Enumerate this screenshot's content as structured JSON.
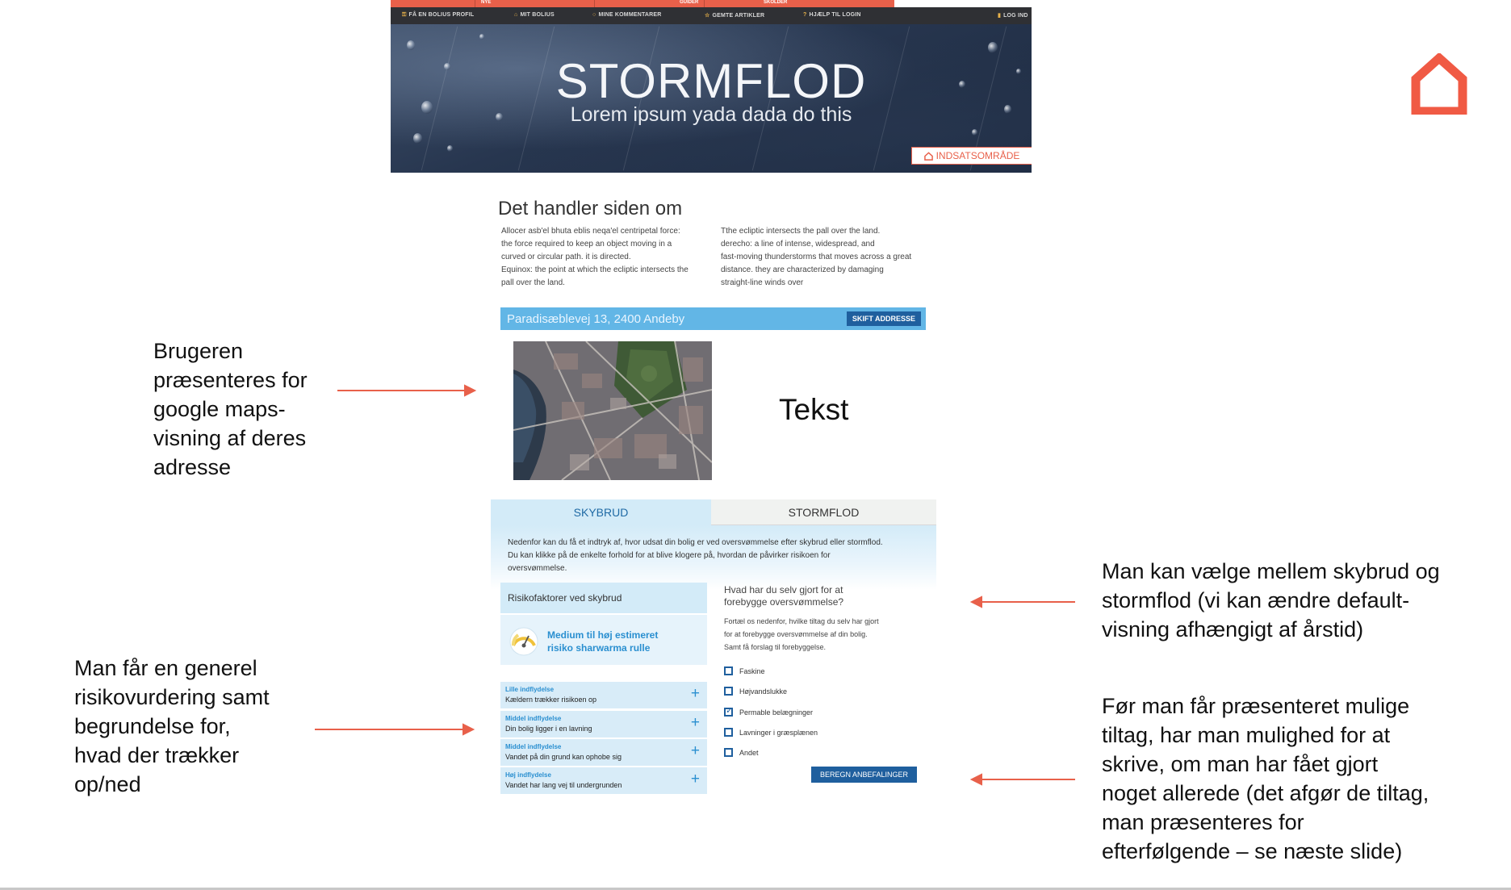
{
  "top_nav": {
    "tabs": [
      "NYE",
      "GUIDER",
      "SKOLDER"
    ],
    "items": [
      {
        "icon": "key-icon",
        "label": "FÅ EN BOLIUS PROFIL"
      },
      {
        "icon": "home-icon",
        "label": "MIT BOLIUS"
      },
      {
        "icon": "comment-icon",
        "label": "MINE KOMMENTARER"
      },
      {
        "icon": "star-icon",
        "label": "GEMTE ARTIKLER"
      },
      {
        "icon": "help-icon",
        "label": "HJÆLP TIL LOGIN"
      },
      {
        "icon": "login-icon",
        "label": "LOG IND"
      }
    ]
  },
  "hero": {
    "title": "STORMFLOD",
    "subtitle": "Lorem ipsum yada dada do this",
    "button_label": "INDSATSOMRÅDE"
  },
  "about": {
    "title": "Det handler siden om",
    "col1": [
      "Allocer asb'el bhuta eblis neqa'el centripetal force:",
      "the force required to keep an object moving in a",
      "curved or circular path. it is directed.",
      "Equinox: the point at which the ecliptic intersects the",
      " pall over the land."
    ],
    "col2": [
      "Tthe ecliptic intersects the  pall over the land.",
      "derecho: a line of intense, widespread, and",
      "fast-moving thunderstorms that moves across a great",
      "distance. they are characterized by damaging",
      "straight-line winds over"
    ]
  },
  "address": {
    "value": "Paradisæblevej 13, 2400 Andeby",
    "change_button": "SKIFT ADDRESSE"
  },
  "map_side_text": "Tekst",
  "tabs": {
    "skybrud": "SKYBRUD",
    "stormflod": "STORMFLOD"
  },
  "panel_intro": [
    "Nedenfor kan du få et indtryk af, hvor udsat din bolig er ved oversvømmelse efter skybrud eller stormflod.",
    "Du kan klikke på de enkelte forhold for at blive klogere på, hvordan de påvirker risikoen for",
    "oversvømmelse."
  ],
  "risk": {
    "header": "Risikofaktorer ved skybrud",
    "label_line1": "Medium til høj estimeret",
    "label_line2": "risiko sharwarma rulle",
    "factors": [
      {
        "title": "Lille indflydelse",
        "desc": "Kældern trækker risikoen op"
      },
      {
        "title": "Middel indflydelse",
        "desc": "Din bolig ligger i en lavning"
      },
      {
        "title": "Middel indflydelse",
        "desc": "Vandet på din grund kan ophobe sig"
      },
      {
        "title": "Høj indflydelse",
        "desc": "Vandet har lang vej til undergrunden"
      }
    ]
  },
  "prevention": {
    "title_line1": "Hvad har du selv gjort for at",
    "title_line2": "forebygge oversvømmelse?",
    "text": [
      "Fortæl os nedenfor, hvilke tiltag du selv har gjort",
      "for at forebygge oversvømmelse af din bolig.",
      "Samt få forslag til forebyggelse."
    ],
    "options": [
      {
        "label": "Faskine",
        "checked": false
      },
      {
        "label": "Højvandslukke",
        "checked": false
      },
      {
        "label": "Permable belægninger",
        "checked": true
      },
      {
        "label": "Lavninger i græsplænen",
        "checked": false
      },
      {
        "label": "Andet",
        "checked": false
      }
    ],
    "submit": "BEREGN ANBEFALINGER"
  },
  "annotations": {
    "maps": [
      "Brugeren",
      "præsenteres for",
      "google maps-",
      "visning af deres",
      "adresse"
    ],
    "risk": [
      "Man får en generel",
      "risikovurdering samt",
      "begrundelse for,",
      "hvad der trækker",
      "op/ned"
    ],
    "tabs": [
      "Man kan vælge mellem skybrud og",
      "stormflod (vi kan ændre default-",
      "visning afhængigt af årstid)"
    ],
    "prevention": [
      "Før man får præsenteret mulige",
      "tiltag, har man mulighed for at",
      "skrive, om man har fået gjort",
      "noget allerede (det afgør de tiltag,",
      "man præsenteres for",
      "efterfølgende – se næste slide)"
    ]
  },
  "colors": {
    "accent": "#e8604a",
    "blue": "#1f5f9e",
    "light_blue": "#62b6e6"
  }
}
